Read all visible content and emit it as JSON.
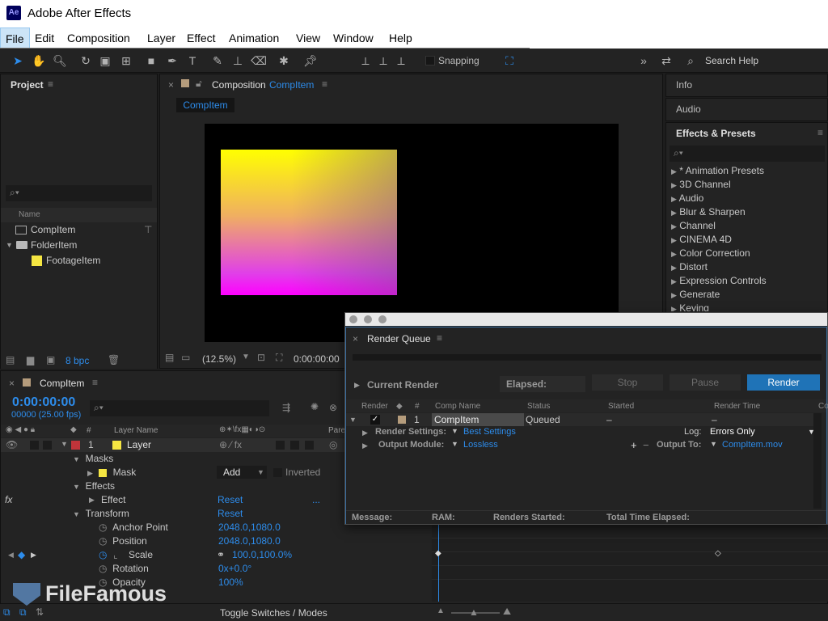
{
  "window": {
    "title": "Adobe After Effects",
    "logo": "Ae"
  },
  "menu": [
    "File",
    "Edit",
    "Composition",
    "Layer",
    "Effect",
    "Animation",
    "View",
    "Window",
    "Help"
  ],
  "toolbar": {
    "snapping": "Snapping",
    "search": "Search Help"
  },
  "project": {
    "title": "Project",
    "col_name": "Name",
    "items": [
      {
        "name": "CompItem",
        "icon": "composition-icon"
      },
      {
        "name": "FolderItem",
        "icon": "folder-icon"
      },
      {
        "name": "FootageItem",
        "icon": "footage-icon",
        "color": "#f5e642"
      }
    ],
    "bpc": "8 bpc"
  },
  "composition": {
    "title": "Composition",
    "name": "CompItem",
    "tab": "CompItem",
    "zoom": "(12.5%)",
    "timecode": "0:00:00:00"
  },
  "right_panels": {
    "info": "Info",
    "audio": "Audio",
    "effects_title": "Effects & Presets",
    "effects": [
      "* Animation Presets",
      "3D Channel",
      "Audio",
      "Blur & Sharpen",
      "Channel",
      "CINEMA 4D",
      "Color Correction",
      "Distort",
      "Expression Controls",
      "Generate",
      "Keying"
    ]
  },
  "timeline": {
    "title": "CompItem",
    "timecode": "0:00:00:00",
    "fps": "00000 (25.00 fps)",
    "col_layer_name": "Layer Name",
    "col_parent": "Pare",
    "layer": {
      "num": "1",
      "name": "Layer",
      "color": "#f5e642",
      "label_color": "#c0343a"
    },
    "rows": [
      {
        "label": "Masks",
        "indent": 1
      },
      {
        "label": "Mask",
        "indent": 2,
        "value": "Add",
        "extra": "Inverted"
      },
      {
        "label": "Effects",
        "indent": 1
      },
      {
        "label": "Effect",
        "indent": 2,
        "value": "Reset",
        "extra": "..."
      },
      {
        "label": "Transform",
        "indent": 1,
        "value": "Reset"
      },
      {
        "label": "Anchor Point",
        "indent": 3,
        "value": "2048.0,1080.0"
      },
      {
        "label": "Position",
        "indent": 3,
        "value": "2048.0,1080.0"
      },
      {
        "label": "Scale",
        "indent": 3,
        "value": "100.0,100.0%"
      },
      {
        "label": "Rotation",
        "indent": 3,
        "value": "0x+0.0°"
      },
      {
        "label": "Opacity",
        "indent": 3,
        "value": "100%"
      }
    ],
    "toggle": "Toggle Switches / Modes"
  },
  "render_queue": {
    "title": "Render Queue",
    "current_render": "Current Render",
    "elapsed": "Elapsed:",
    "stop": "Stop",
    "pause": "Pause",
    "render": "Render",
    "columns": [
      "Render",
      "#",
      "Comp Name",
      "Status",
      "Started",
      "Render Time",
      "Co"
    ],
    "item": {
      "num": "1",
      "comp": "CompItem",
      "status": "Queued",
      "started": "–",
      "render_time": "–"
    },
    "render_settings_label": "Render Settings:",
    "render_settings": "Best Settings",
    "output_module_label": "Output Module:",
    "output_module": "Lossless",
    "log_label": "Log:",
    "log": "Errors Only",
    "output_to_label": "Output To:",
    "output_to": "CompItem.mov",
    "footer": {
      "message": "Message:",
      "ram": "RAM:",
      "renders_started": "Renders Started:",
      "total_time": "Total Time Elapsed:"
    }
  },
  "watermark": "FileFamous"
}
